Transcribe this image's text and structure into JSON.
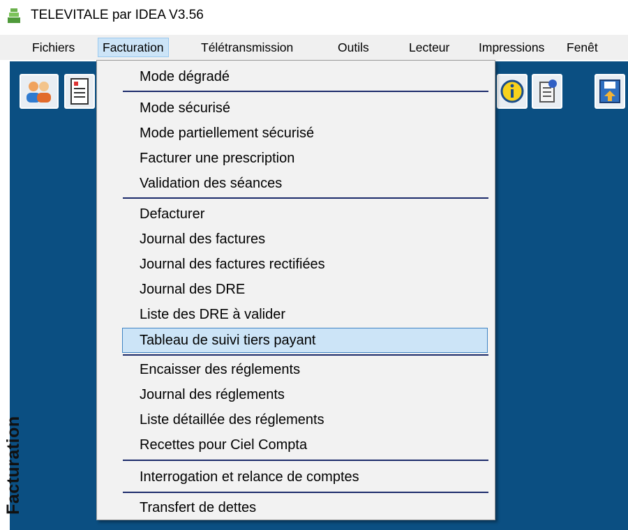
{
  "window": {
    "title": "TELEVITALE par IDEA V3.56"
  },
  "menubar": {
    "items": [
      {
        "label": "Fichiers"
      },
      {
        "label": "Facturation"
      },
      {
        "label": "Télétransmission"
      },
      {
        "label": "Outils"
      },
      {
        "label": "Lecteur"
      },
      {
        "label": "Impressions"
      },
      {
        "label": "Fenêt"
      }
    ],
    "active": "Facturation"
  },
  "dropdown": {
    "strip_label": "Facturation",
    "items": [
      {
        "label": "Mode dégradé"
      },
      {
        "label": "Mode sécurisé"
      },
      {
        "label": "Mode partiellement sécurisé"
      },
      {
        "label": "Facturer une prescription"
      },
      {
        "label": "Validation des séances"
      },
      {
        "label": "Defacturer"
      },
      {
        "label": "Journal des factures"
      },
      {
        "label": "Journal des factures rectifiées"
      },
      {
        "label": "Journal des DRE"
      },
      {
        "label": "Liste des DRE à valider"
      },
      {
        "label": "Tableau de suivi tiers payant"
      },
      {
        "label": "Encaisser des réglements"
      },
      {
        "label": "Journal des réglements"
      },
      {
        "label": "Liste détaillée des réglements"
      },
      {
        "label": "Recettes pour Ciel Compta"
      },
      {
        "label": "Interrogation et relance de comptes"
      },
      {
        "label": "Transfert de dettes"
      }
    ],
    "highlighted": "Tableau de suivi tiers payant"
  },
  "toolbar": {
    "icons": [
      "patients-icon",
      "document-icon",
      "info-icon",
      "notes-icon",
      "save-transfer-icon"
    ]
  },
  "colors": {
    "workspace": "#0b4f82",
    "menu_highlight": "#cce4f7",
    "separator": "#1b2a6a"
  }
}
